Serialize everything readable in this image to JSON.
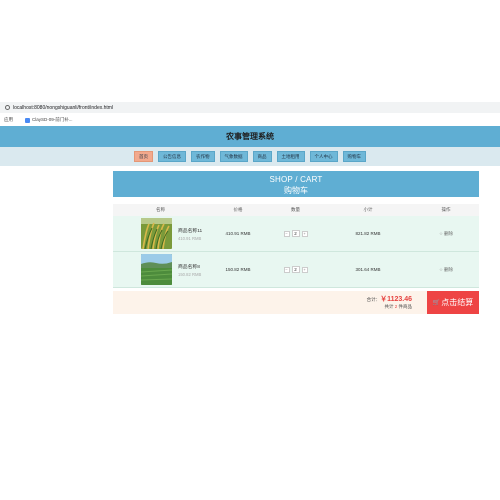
{
  "browser": {
    "url": "localhost:8080/nongshiguanli/front/index.html",
    "bookmarks_label": "应用",
    "bookmark_item": "ClaySD-09-前门补..."
  },
  "site": {
    "title": "农事管理系统"
  },
  "nav": {
    "items": [
      {
        "label": "首页",
        "active": true
      },
      {
        "label": "公告信息",
        "active": false
      },
      {
        "label": "农作物",
        "active": false
      },
      {
        "label": "气象数据",
        "active": false
      },
      {
        "label": "商品",
        "active": false
      },
      {
        "label": "土地租用",
        "active": false
      },
      {
        "label": "个人中心",
        "active": false
      },
      {
        "label": "购物车",
        "active": false
      }
    ]
  },
  "cart": {
    "title_en": "SHOP / CART",
    "title_cn": "购物车",
    "columns": [
      "名称",
      "价格",
      "数量",
      "小计",
      "操作"
    ],
    "items": [
      {
        "name": "商品名称11",
        "price_small": "410.91 RMB",
        "price": "410.91 RMB",
        "quantity": "2",
        "subtotal": "821.82 RMB",
        "action": "删除",
        "thumb": "rice-field"
      },
      {
        "name": "商品名称8",
        "price_small": "150.82 RMB",
        "price": "150.82 RMB",
        "quantity": "2",
        "subtotal": "301.64 RMB",
        "action": "删除",
        "thumb": "green-field"
      }
    ],
    "total_label": "合计：",
    "total_amount": "￥1123.46",
    "count_prefix": "共计",
    "count_value": "2",
    "count_suffix": "件商品",
    "checkout_label": "点击结算"
  },
  "colors": {
    "header_blue": "#5faed3",
    "nav_bg": "#dae9ef",
    "active_nav": "#f2a98d",
    "row_bg": "#e8f7f1",
    "checkout_red": "#ee4444"
  }
}
